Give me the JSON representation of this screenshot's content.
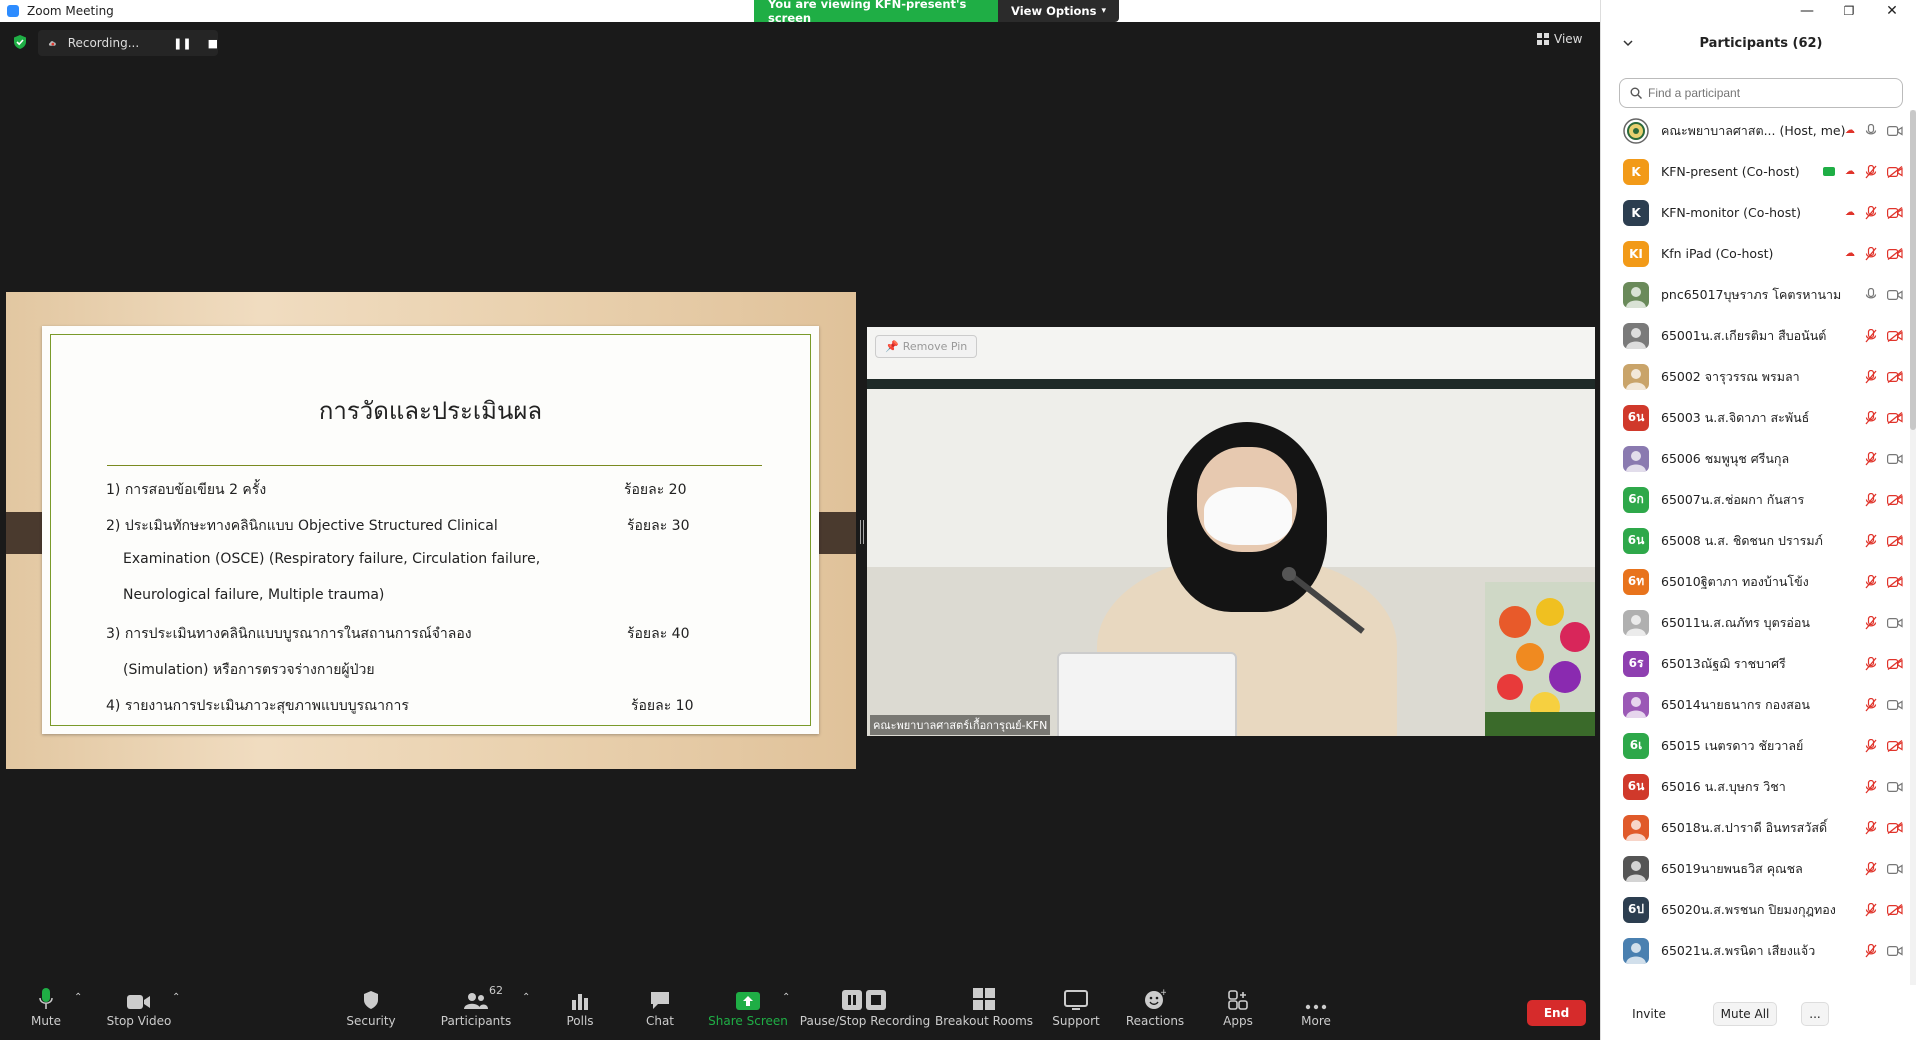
{
  "window": {
    "title": "Zoom Meeting"
  },
  "banner": {
    "viewing": "You are viewing KFN-present's screen",
    "view_options": "View Options"
  },
  "recording": {
    "status": "Recording..."
  },
  "view_button": {
    "label": "View"
  },
  "slide": {
    "title": "การวัดและประเมินผล",
    "lines": [
      "1) การสอบข้อเขียน 2 ครั้ง",
      "2) ประเมินทักษะทางคลินิกแบบ Objective Structured Clinical",
      "Examination (OSCE) (Respiratory failure, Circulation failure,",
      "Neurological failure, Multiple trauma)",
      "3) การประเมินทางคลินิกแบบบูรณาการในสถานการณ์จำลอง",
      "(Simulation) หรือการตรวจร่างกายผู้ป่วย",
      "4) รายงานการประเมินภาวะสุขภาพแบบบูรณาการ"
    ],
    "percents": [
      "ร้อยละ 20",
      "ร้อยละ 30",
      "ร้อยละ 40",
      "ร้อยละ 10"
    ]
  },
  "video": {
    "remove_pin": "Remove Pin",
    "name": "คณะพยาบาลศาสตร์เกื้อการุณย์-KFN"
  },
  "toolbar": {
    "mute": "Mute",
    "stop_video": "Stop Video",
    "security": "Security",
    "participants": "Participants",
    "participants_count": "62",
    "polls": "Polls",
    "chat": "Chat",
    "share_screen": "Share Screen",
    "pause_stop_recording": "Pause/Stop Recording",
    "breakout_rooms": "Breakout Rooms",
    "support": "Support",
    "reactions": "Reactions",
    "apps": "Apps",
    "more": "More",
    "end": "End"
  },
  "panel": {
    "title": "Participants (62)",
    "search_placeholder": "Find a participant",
    "invite": "Invite",
    "mute_all": "Mute All",
    "more": "...",
    "participants": [
      {
        "initials": "",
        "name": "คณะพยาบาลศาสต...  (Host, me)",
        "color": "#ffffff",
        "photo": true
      },
      {
        "initials": "K",
        "name": "KFN-present (Co-host)",
        "color": "#f29a18"
      },
      {
        "initials": "K",
        "name": "KFN-monitor (Co-host)",
        "color": "#2c3e50"
      },
      {
        "initials": "KI",
        "name": "Kfn iPad (Co-host)",
        "color": "#f29a18"
      },
      {
        "initials": "",
        "name": "pnc65017บุษราภร โคตรหานาม",
        "color": "#6a8a5a",
        "photo": true
      },
      {
        "initials": "",
        "name": "65001น.ส.เกียรติมา สืบอนันต์",
        "color": "#7a7a7a",
        "photo": true
      },
      {
        "initials": "",
        "name": "65002 จารุวรรณ พรมลา",
        "color": "#c9a46a",
        "photo": true
      },
      {
        "initials": "6น",
        "name": "65003 น.ส.จิดาภา สะพันธ์",
        "color": "#d0392b"
      },
      {
        "initials": "",
        "name": "65006 ชมพูนุช ศรีนกุล",
        "color": "#8a7ab0",
        "photo": true
      },
      {
        "initials": "6ก",
        "name": "65007น.ส.ช่อผกา กันสาร",
        "color": "#2ea84a"
      },
      {
        "initials": "6น",
        "name": "65008 น.ส. ชิดชนก ปรารมภ์",
        "color": "#2ea84a"
      },
      {
        "initials": "6ท",
        "name": "65010ฐิตาภา ทองบ้านโข้ง",
        "color": "#e8731c"
      },
      {
        "initials": "",
        "name": "65011น.ส.ณภัทร บุตรอ่อน",
        "color": "#b0b0b0",
        "photo": true
      },
      {
        "initials": "6ร",
        "name": "65013ณัฐฌิ      ราชบาศรี",
        "color": "#8e3fb0"
      },
      {
        "initials": "",
        "name": "65014นายธนากร กองสอน",
        "color": "#9b59b6",
        "photo": true
      },
      {
        "initials": "6เ",
        "name": "65015 เนตรดาว ชัยวาลย์",
        "color": "#2ea84a"
      },
      {
        "initials": "6น",
        "name": "65016 น.ส.บุษกร วิชา",
        "color": "#d0392b"
      },
      {
        "initials": "",
        "name": "65018น.ส.ปาราดี อินทรสวัสดิ์",
        "color": "#e05a2a",
        "photo": true
      },
      {
        "initials": "",
        "name": "65019นายพนธวิส คุณชล",
        "color": "#555555",
        "photo": true
      },
      {
        "initials": "6ป",
        "name": "65020น.ส.พรชนก ปิยมงกุฎทอง",
        "color": "#2c3e50"
      },
      {
        "initials": "",
        "name": "65021น.ส.พรนิดา เสียงแจ้ว",
        "color": "#4a80b0",
        "photo": true
      }
    ]
  }
}
